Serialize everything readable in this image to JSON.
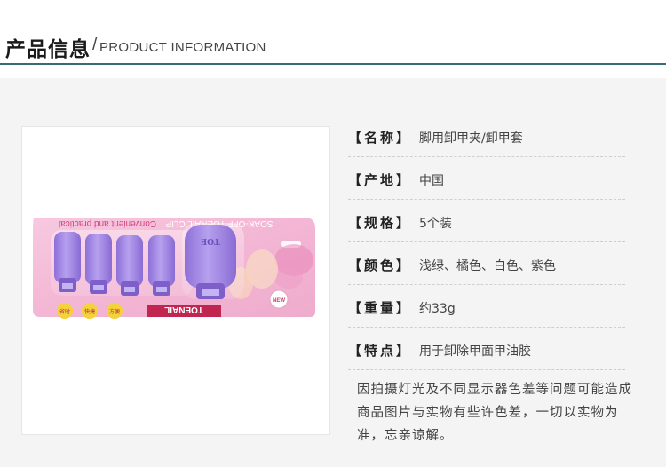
{
  "header": {
    "title_cn": "产品信息",
    "slash": "/",
    "title_en": "PRODUCT INFORMATION"
  },
  "product_image": {
    "package_text_top": "Convenient and practical",
    "package_text_brand": "SOAK-OFF TOENAIL CLIP",
    "package_text_bottom": "TOENAIL",
    "stickers": [
      "省时",
      "快捷",
      "方便"
    ],
    "badge": "NEW",
    "clip_mark": "TOE",
    "clip_color": "#a98ee6",
    "card_color": "#f2b8d6"
  },
  "specs": [
    {
      "label": "【名称】",
      "value": "脚用卸甲夹/卸甲套"
    },
    {
      "label": "【产地】",
      "value": "中国"
    },
    {
      "label": "【规格】",
      "value": "5个装"
    },
    {
      "label": "【颜色】",
      "value": "浅绿、橘色、白色、紫色"
    },
    {
      "label": "【重量】",
      "value": "约33g"
    },
    {
      "label": "【特点】",
      "value": "用于卸除甲面甲油胶"
    }
  ],
  "note": "因拍摄灯光及不同显示器色差等问题可能造成商品图片与实物有些许色差，一切以实物为准，忘亲谅解。"
}
